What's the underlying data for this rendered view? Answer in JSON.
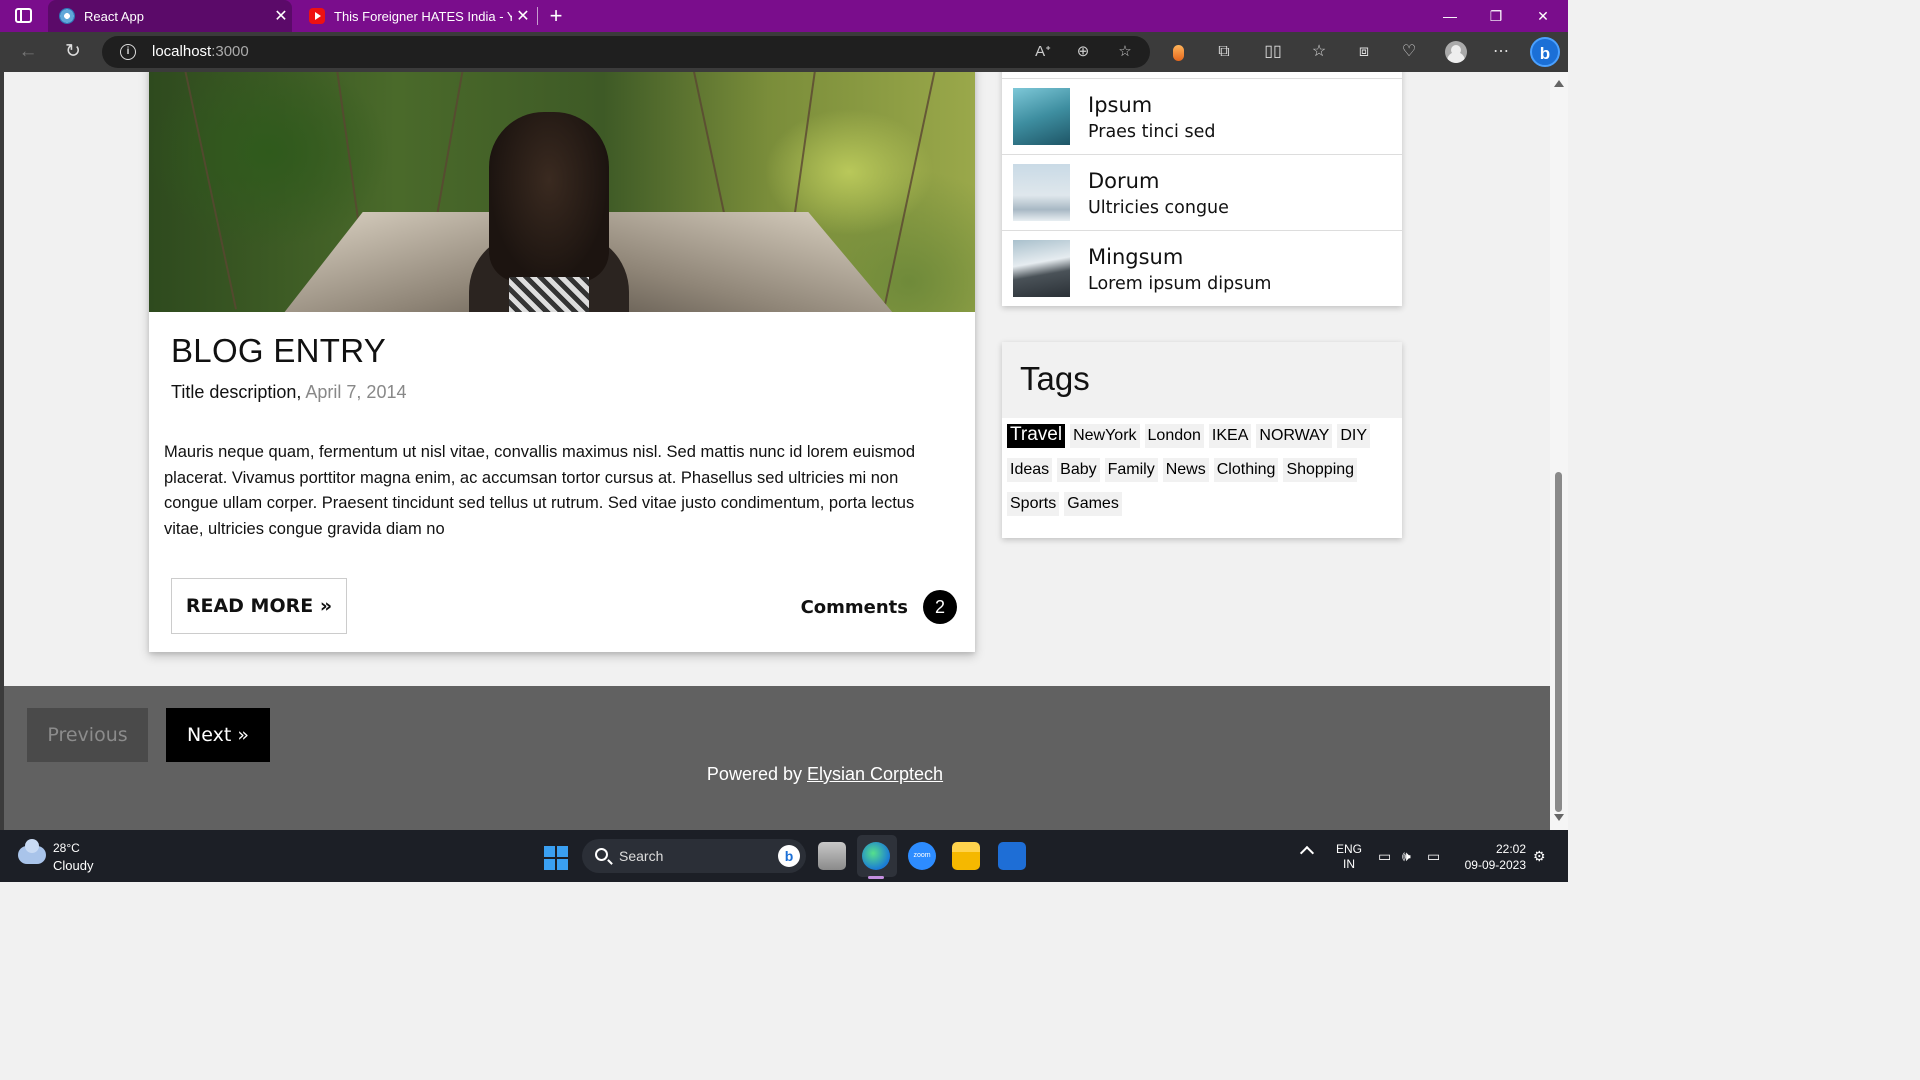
{
  "browser": {
    "tabs": [
      {
        "title": "React App",
        "active": true
      },
      {
        "title": "This Foreigner HATES India - You"
      }
    ],
    "new_tab": "+",
    "address": {
      "host": "localhost",
      "port": ":3000"
    },
    "window_controls": {
      "minimize": "—",
      "restore": "❐",
      "close": "✕"
    }
  },
  "blog": {
    "title": "BLOG ENTRY",
    "subtitle": "Title description,",
    "date": "April 7, 2014",
    "body": "Mauris neque quam, fermentum ut nisl vitae, convallis maximus nisl. Sed mattis nunc id lorem euismod placerat. Vivamus porttitor magna enim, ac accumsan tortor cursus at. Phasellus sed ultricies mi non congue ullam corper. Praesent tincidunt sed tellus ut rutrum. Sed vitae justo condimentum, porta lectus vitae, ultricies congue gravida diam no",
    "read_more": "READ MORE »",
    "comments_label": "Comments",
    "comments_count": "2"
  },
  "popular_posts": [
    {
      "title": "Ipsum",
      "desc": "Praes tinci sed"
    },
    {
      "title": "Dorum",
      "desc": "Ultricies congue"
    },
    {
      "title": "Mingsum",
      "desc": "Lorem ipsum dipsum"
    }
  ],
  "tags": {
    "title": "Tags",
    "items": [
      "Travel",
      "NewYork",
      "London",
      "IKEA",
      "NORWAY",
      "DIY",
      "Ideas",
      "Baby",
      "Family",
      "News",
      "Clothing",
      "Shopping",
      "Sports",
      "Games"
    ],
    "active": "Travel"
  },
  "footer": {
    "previous": "Previous",
    "next": "Next »",
    "powered_by": "Powered by",
    "company": "Elysian Corptech"
  },
  "taskbar": {
    "weather_temp": "28°C",
    "weather_cond": "Cloudy",
    "search_placeholder": "Search",
    "lang_1": "ENG",
    "lang_2": "IN",
    "time": "22:02",
    "date": "09-09-2023"
  }
}
